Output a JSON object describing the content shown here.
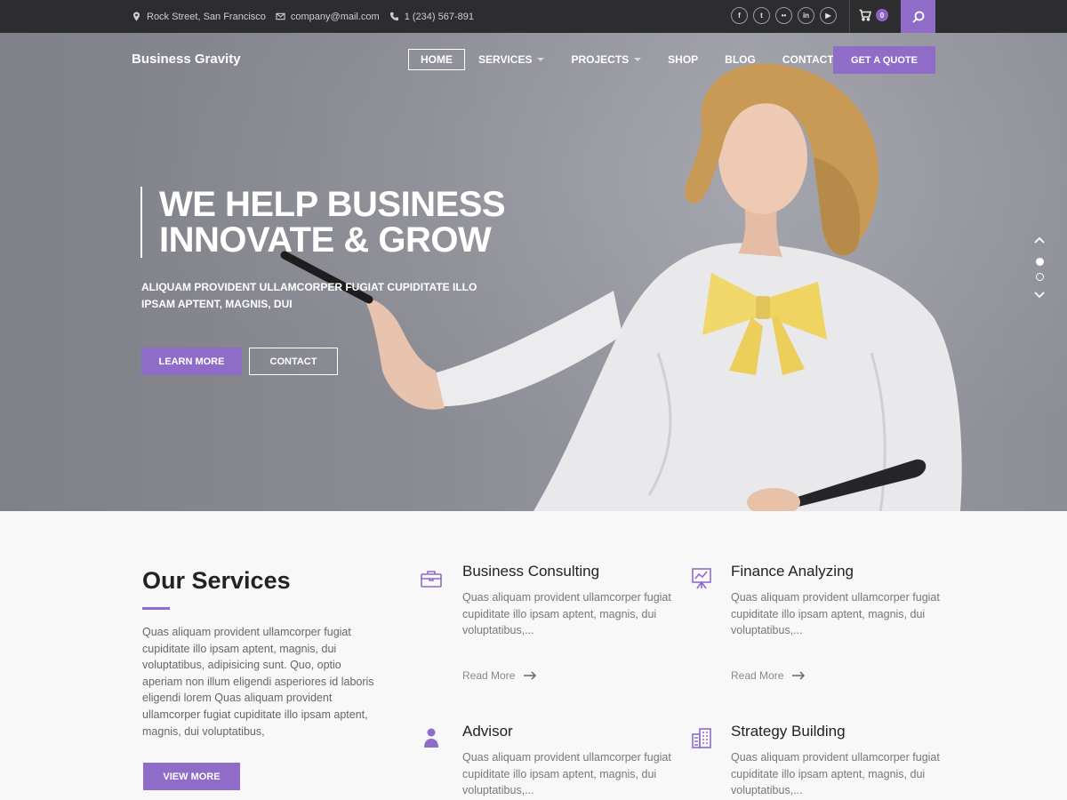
{
  "topbar": {
    "address": "Rock Street, San Francisco",
    "email": "company@mail.com",
    "phone": "1 (234) 567-891",
    "social": [
      {
        "icon": "facebook-icon",
        "glyph": "f"
      },
      {
        "icon": "twitter-icon",
        "glyph": "t"
      },
      {
        "icon": "flickr-icon",
        "glyph": "••"
      },
      {
        "icon": "linkedin-icon",
        "glyph": "in"
      },
      {
        "icon": "youtube-icon",
        "glyph": "▶"
      }
    ],
    "cart_count": "0"
  },
  "header": {
    "brand": "Business Gravity",
    "nav": [
      {
        "label": "HOME",
        "active": true,
        "dropdown": false
      },
      {
        "label": "SERVICES",
        "active": false,
        "dropdown": true
      },
      {
        "label": "PROJECTS",
        "active": false,
        "dropdown": true
      },
      {
        "label": "SHOP",
        "active": false,
        "dropdown": false
      },
      {
        "label": "BLOG",
        "active": false,
        "dropdown": false
      },
      {
        "label": "CONTACT",
        "active": false,
        "dropdown": false
      }
    ],
    "quote_label": "GET A QUOTE"
  },
  "hero": {
    "line1": "WE HELP BUSINESS",
    "line2": "INNOVATE & GROW",
    "subtitle": "ALIQUAM PROVIDENT ULLAMCORPER FUGIAT CUPIDITATE ILLO IPSAM APTENT, MAGNIS, DUI",
    "learn_label": "LEARN MORE",
    "contact_label": "CONTACT"
  },
  "services": {
    "title": "Our Services",
    "description": "Quas aliquam provident ullamcorper fugiat cupiditate illo ipsam aptent, magnis, dui voluptatibus, adipisicing sunt. Quo, optio aperiam non illum eligendi asperiores id laboris eligendi lorem Quas aliquam provident ullamcorper fugiat cupiditate illo ipsam aptent, magnis, dui voluptatibus,",
    "view_more_label": "VIEW MORE",
    "items": [
      {
        "title": "Business Consulting",
        "text": "Quas aliquam provident ullamcorper fugiat cupiditate illo ipsam aptent, magnis, dui voluptatibus,...",
        "more": "Read More",
        "icon": "briefcase-icon"
      },
      {
        "title": "Finance Analyzing",
        "text": "Quas aliquam provident ullamcorper fugiat cupiditate illo ipsam aptent, magnis, dui voluptatibus,...",
        "more": "Read More",
        "icon": "chart-board-icon"
      },
      {
        "title": "Advisor",
        "text": "Quas aliquam provident ullamcorper fugiat cupiditate illo ipsam aptent, magnis, dui voluptatibus,...",
        "icon": "person-icon"
      },
      {
        "title": "Strategy Building",
        "text": "Quas aliquam provident ullamcorper fugiat cupiditate illo ipsam aptent, magnis, dui voluptatibus,...",
        "icon": "building-icon"
      }
    ]
  },
  "colors": {
    "accent": "#8e6cc8",
    "topbar": "#2d2d2f"
  }
}
